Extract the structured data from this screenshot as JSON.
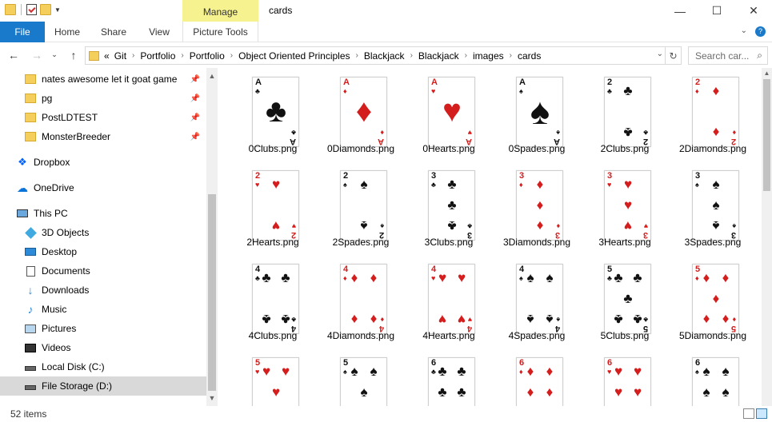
{
  "window": {
    "title": "cards",
    "manage_label": "Manage",
    "minimize": "—",
    "maximize": "☐",
    "close": "✕"
  },
  "ribbon": {
    "tabs": [
      "File",
      "Home",
      "Share",
      "View"
    ],
    "picture_tools": "Picture Tools"
  },
  "address": {
    "crumbs": [
      "«",
      "Git",
      "Portfolio",
      "Portfolio",
      "Object Oriented Principles",
      "Blackjack",
      "Blackjack",
      "images",
      "cards"
    ],
    "search_placeholder": "Search car..."
  },
  "nav": {
    "quick_access": [
      {
        "label": "nates awesome let it goat game",
        "pinned": true
      },
      {
        "label": "pg",
        "pinned": true
      },
      {
        "label": "PostLDTEST",
        "pinned": true
      },
      {
        "label": "MonsterBreeder",
        "pinned": true
      }
    ],
    "dropbox": "Dropbox",
    "onedrive": "OneDrive",
    "thispc": "This PC",
    "pc_items": [
      {
        "label": "3D Objects",
        "icon": "cube-icon"
      },
      {
        "label": "Desktop",
        "icon": "desktop-icon"
      },
      {
        "label": "Documents",
        "icon": "documents-icon"
      },
      {
        "label": "Downloads",
        "icon": "downloads-icon"
      },
      {
        "label": "Music",
        "icon": "music-icon"
      },
      {
        "label": "Pictures",
        "icon": "pictures-icon"
      },
      {
        "label": "Videos",
        "icon": "videos-icon"
      },
      {
        "label": "Local Disk (C:)",
        "icon": "disk-icon"
      },
      {
        "label": "File Storage (D:)",
        "icon": "disk-icon"
      }
    ]
  },
  "files": [
    {
      "name": "0Clubs.png",
      "rank": "A",
      "suit": "clubs"
    },
    {
      "name": "0Diamonds.png",
      "rank": "A",
      "suit": "diamonds"
    },
    {
      "name": "0Hearts.png",
      "rank": "A",
      "suit": "hearts"
    },
    {
      "name": "0Spades.png",
      "rank": "A",
      "suit": "spades"
    },
    {
      "name": "2Clubs.png",
      "rank": "2",
      "suit": "clubs"
    },
    {
      "name": "2Diamonds.png",
      "rank": "2",
      "suit": "diamonds"
    },
    {
      "name": "2Hearts.png",
      "rank": "2",
      "suit": "hearts"
    },
    {
      "name": "2Spades.png",
      "rank": "2",
      "suit": "spades"
    },
    {
      "name": "3Clubs.png",
      "rank": "3",
      "suit": "clubs"
    },
    {
      "name": "3Diamonds.png",
      "rank": "3",
      "suit": "diamonds"
    },
    {
      "name": "3Hearts.png",
      "rank": "3",
      "suit": "hearts"
    },
    {
      "name": "3Spades.png",
      "rank": "3",
      "suit": "spades"
    },
    {
      "name": "4Clubs.png",
      "rank": "4",
      "suit": "clubs"
    },
    {
      "name": "4Diamonds.png",
      "rank": "4",
      "suit": "diamonds"
    },
    {
      "name": "4Hearts.png",
      "rank": "4",
      "suit": "hearts"
    },
    {
      "name": "4Spades.png",
      "rank": "4",
      "suit": "spades"
    },
    {
      "name": "5Clubs.png",
      "rank": "5",
      "suit": "clubs"
    },
    {
      "name": "5Diamonds.png",
      "rank": "5",
      "suit": "diamonds"
    },
    {
      "name": "",
      "rank": "5",
      "suit": "hearts"
    },
    {
      "name": "",
      "rank": "5",
      "suit": "spades"
    },
    {
      "name": "",
      "rank": "6",
      "suit": "clubs"
    },
    {
      "name": "",
      "rank": "6",
      "suit": "diamonds"
    },
    {
      "name": "",
      "rank": "6",
      "suit": "hearts"
    },
    {
      "name": "",
      "rank": "6",
      "suit": "spades"
    }
  ],
  "status": {
    "items": "52 items"
  },
  "colors": {
    "accent": "#1979ca",
    "manage": "#f6f290",
    "red_suit": "#d41d1d"
  }
}
